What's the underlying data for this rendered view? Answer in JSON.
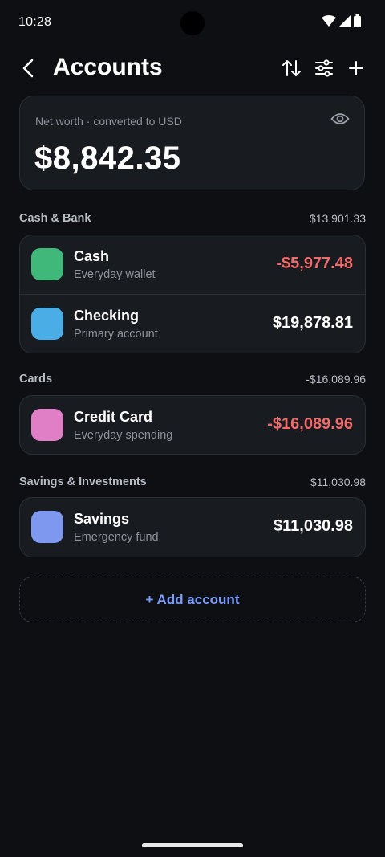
{
  "status_bar": {
    "time": "10:28",
    "icons": [
      "wifi-icon",
      "signal-icon",
      "battery-icon"
    ]
  },
  "app_bar": {
    "title": "Accounts",
    "actions": [
      "sort-icon",
      "filter-icon",
      "add-icon"
    ]
  },
  "net_worth": {
    "label": "Net worth · converted to USD",
    "value": "$8,842.35"
  },
  "sections": [
    {
      "name": "Cash & Bank",
      "total": "$13,901.33",
      "accounts": [
        {
          "name": "Cash",
          "subtitle": "Everyday wallet",
          "balance": "-$5,977.48",
          "negative": true,
          "color": "#3fb87a"
        },
        {
          "name": "Checking",
          "subtitle": "Primary account",
          "balance": "$19,878.81",
          "negative": false,
          "color": "#4aade6"
        }
      ]
    },
    {
      "name": "Cards",
      "total": "-$16,089.96",
      "accounts": [
        {
          "name": "Credit Card",
          "subtitle": "Everyday spending",
          "balance": "-$16,089.96",
          "negative": true,
          "color": "#e07fc6"
        }
      ]
    },
    {
      "name": "Savings & Investments",
      "total": "$11,030.98",
      "accounts": [
        {
          "name": "Savings",
          "subtitle": "Emergency fund",
          "balance": "$11,030.98",
          "negative": false,
          "color": "#7d98ee"
        }
      ]
    }
  ],
  "add_account_label": "+ Add account",
  "colors": {
    "background": "#0d0f13",
    "card": "#181b20",
    "negative": "#f06a6a",
    "accent": "#7b9cff"
  }
}
